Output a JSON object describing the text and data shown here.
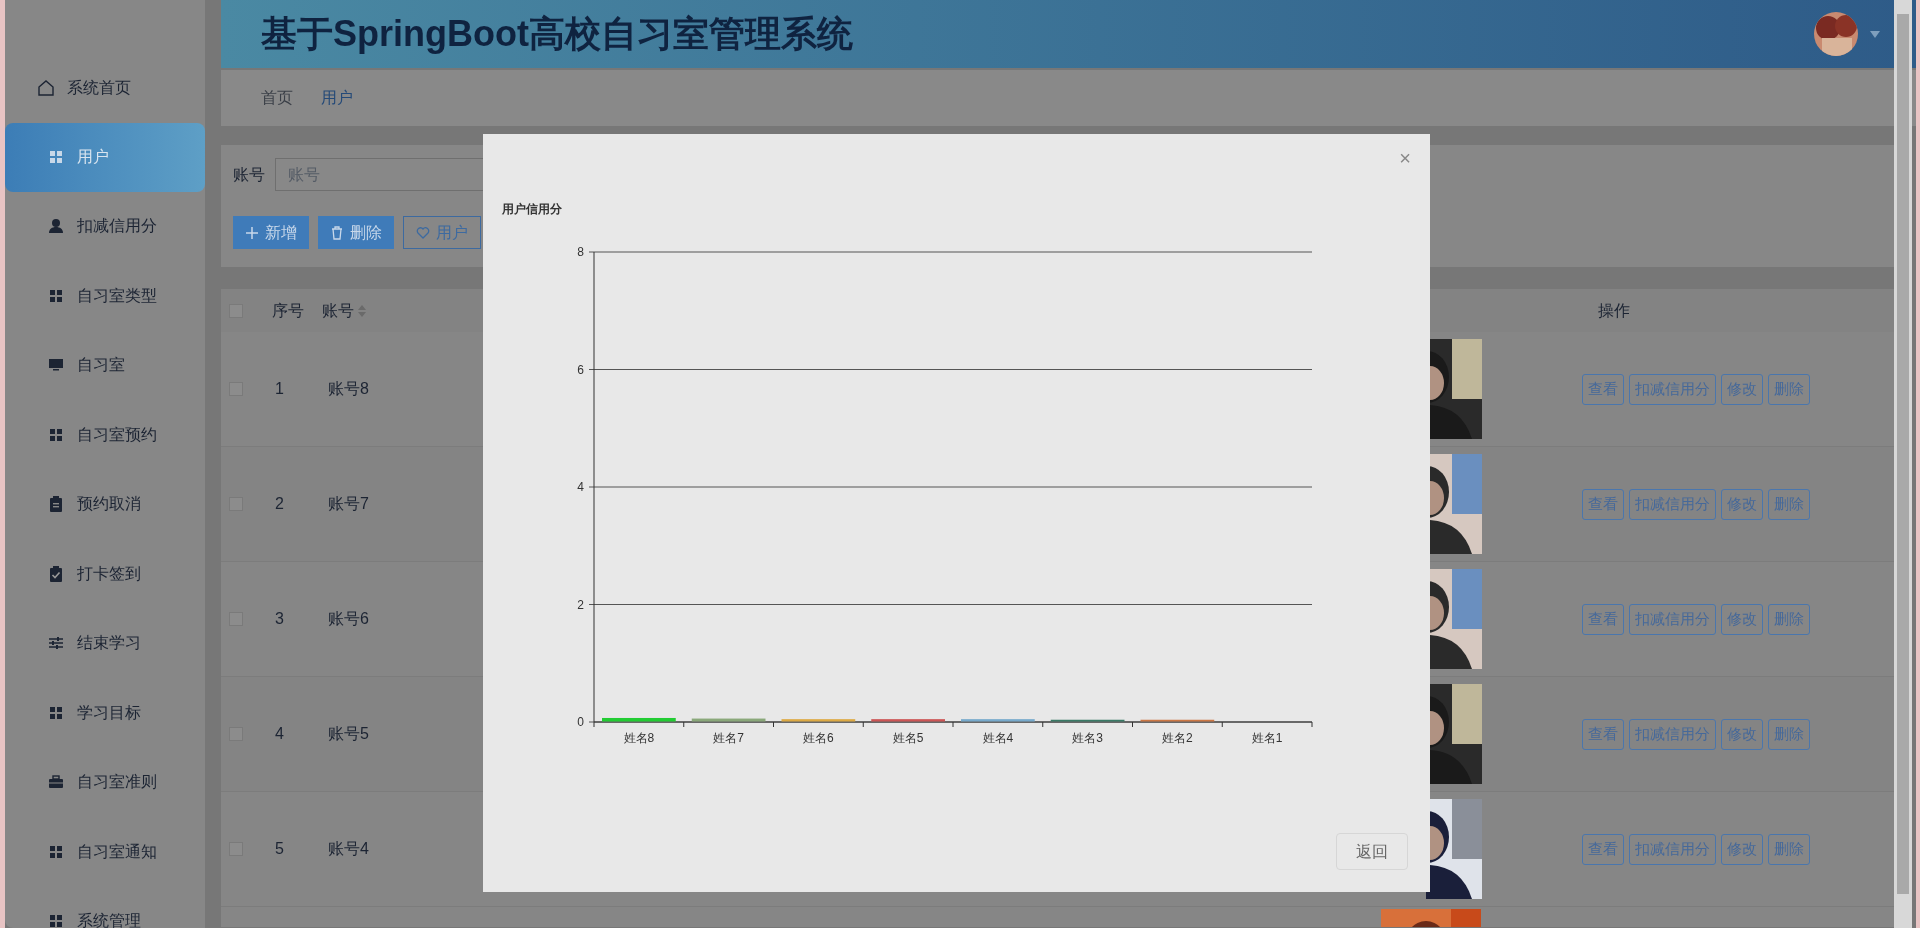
{
  "header": {
    "title": "基于SpringBoot高校自习室管理系统"
  },
  "sidebar": {
    "items": [
      {
        "label": "系统首页",
        "kind": "home",
        "selected": false
      },
      {
        "label": "用户",
        "kind": "grid",
        "selected": true
      },
      {
        "label": "扣减信用分",
        "kind": "user",
        "selected": false
      },
      {
        "label": "自习室类型",
        "kind": "grid",
        "selected": false
      },
      {
        "label": "自习室",
        "kind": "monitor",
        "selected": false
      },
      {
        "label": "自习室预约",
        "kind": "grid",
        "selected": false
      },
      {
        "label": "预约取消",
        "kind": "clipboard",
        "selected": false
      },
      {
        "label": "打卡签到",
        "kind": "check",
        "selected": false
      },
      {
        "label": "结束学习",
        "kind": "sliders",
        "selected": false
      },
      {
        "label": "学习目标",
        "kind": "grid",
        "selected": false
      },
      {
        "label": "自习室准则",
        "kind": "briefcase",
        "selected": false
      },
      {
        "label": "自习室通知",
        "kind": "grid",
        "selected": false
      },
      {
        "label": "系统管理",
        "kind": "grid",
        "selected": false
      }
    ]
  },
  "breadcrumb": [
    {
      "label": "首页",
      "selected": false
    },
    {
      "label": "用户",
      "selected": true
    }
  ],
  "search": {
    "label": "账号",
    "placeholder": "账号"
  },
  "toolbar": [
    {
      "label": "新增",
      "kind": "plus"
    },
    {
      "label": "删除",
      "kind": "trash"
    },
    {
      "label": "用户",
      "kind": "heart"
    }
  ],
  "table": {
    "header_checked": false,
    "columns": [
      "序号",
      "账号",
      "操作"
    ],
    "rows": [
      {
        "index": "1",
        "account": "账号8",
        "checked": false,
        "actions": [
          "查看",
          "扣减信用分",
          "修改",
          "删除"
        ]
      },
      {
        "index": "2",
        "account": "账号7",
        "checked": false,
        "actions": [
          "查看",
          "扣减信用分",
          "修改",
          "删除"
        ]
      },
      {
        "index": "3",
        "account": "账号6",
        "checked": false,
        "actions": [
          "查看",
          "扣减信用分",
          "修改",
          "删除"
        ]
      },
      {
        "index": "4",
        "account": "账号5",
        "checked": false,
        "actions": [
          "查看",
          "扣减信用分",
          "修改",
          "删除"
        ]
      },
      {
        "index": "5",
        "account": "账号4",
        "checked": false,
        "actions": [
          "查看",
          "扣减信用分",
          "修改",
          "删除"
        ]
      }
    ],
    "cut_row": {
      "kind": "picture"
    }
  },
  "modal": {
    "close": "×",
    "button": "返回",
    "chart_data": {
      "type": "bar",
      "title": "用户信用分",
      "grid": true,
      "categories": [
        "姓名8",
        "姓名7",
        "姓名6",
        "姓名5",
        "姓名4",
        "姓名3",
        "姓名2",
        "姓名1"
      ],
      "values": [
        0.06,
        0.05,
        0.04,
        0.04,
        0.04,
        0.03,
        0.03,
        null
      ],
      "ylim": [
        0,
        8
      ],
      "yticks": [
        0,
        2,
        4,
        6,
        8
      ]
    }
  }
}
